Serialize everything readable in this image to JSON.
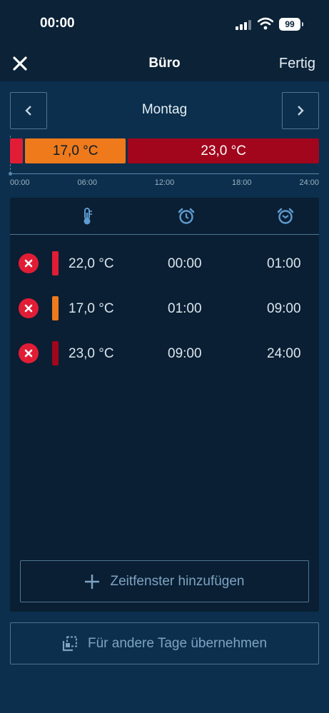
{
  "status": {
    "time": "00:00",
    "battery": "99"
  },
  "header": {
    "title": "Büro",
    "done_label": "Fertig"
  },
  "day": {
    "label": "Montag"
  },
  "timeline": {
    "segments": [
      {
        "label": "",
        "from_hour": 0,
        "to_hour": 1,
        "color": "#e11d36"
      },
      {
        "label": "17,0 °C",
        "from_hour": 1,
        "to_hour": 9,
        "color": "#ee7a1c"
      },
      {
        "label": "23,0 °C",
        "from_hour": 9,
        "to_hour": 24,
        "color": "#a1061d"
      }
    ],
    "ticks": [
      "00:00",
      "06:00",
      "12:00",
      "18:00",
      "24:00"
    ]
  },
  "table": {
    "rows": [
      {
        "temp": "22,0 °C",
        "start": "00:00",
        "end": "01:00",
        "color": "#e11d36"
      },
      {
        "temp": "17,0 °C",
        "start": "01:00",
        "end": "09:00",
        "color": "#ee7a1c"
      },
      {
        "temp": "23,0 °C",
        "start": "09:00",
        "end": "24:00",
        "color": "#a1061d"
      }
    ]
  },
  "actions": {
    "add_label": "Zeitfenster hinzufügen",
    "copy_label": "Für andere Tage übernehmen"
  }
}
